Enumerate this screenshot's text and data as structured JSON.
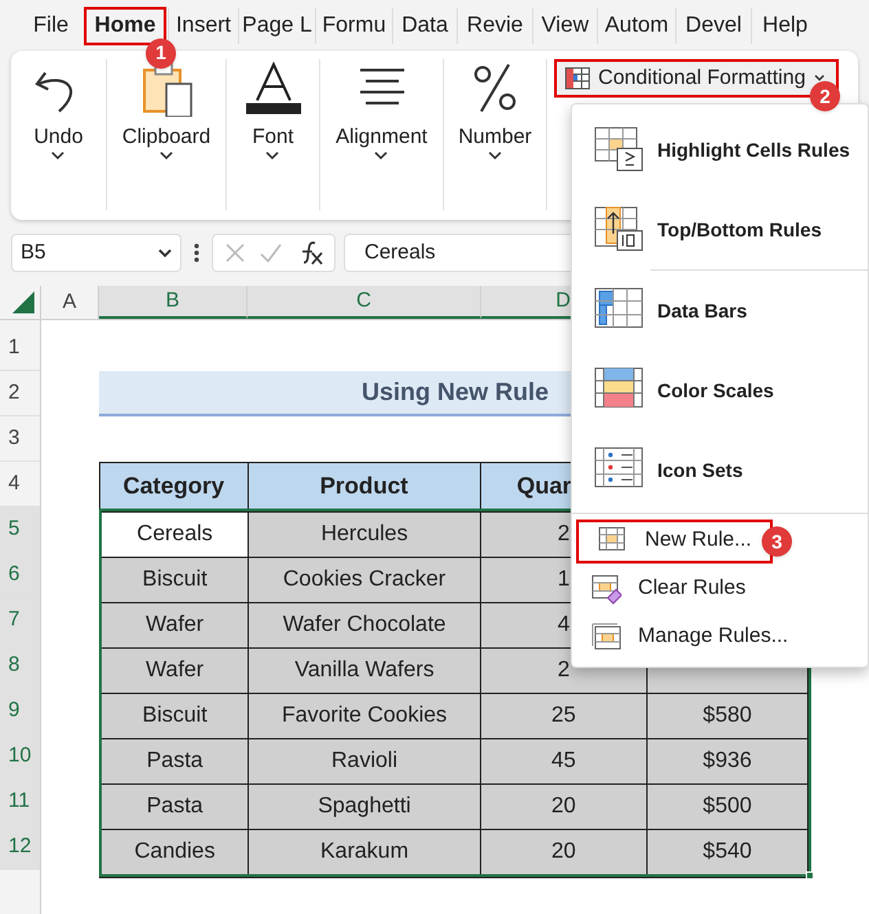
{
  "tabs": [
    {
      "label": "File",
      "selected": false
    },
    {
      "label": "Home",
      "selected": true,
      "callout": "1"
    },
    {
      "label": "Insert",
      "selected": false
    },
    {
      "label": "Page L",
      "selected": false
    },
    {
      "label": "Formu",
      "selected": false
    },
    {
      "label": "Data",
      "selected": false
    },
    {
      "label": "Revie",
      "selected": false
    },
    {
      "label": "View",
      "selected": false
    },
    {
      "label": "Autom",
      "selected": false
    },
    {
      "label": "Devel",
      "selected": false
    },
    {
      "label": "Help",
      "selected": false
    }
  ],
  "ribbon": {
    "groups": [
      "Undo",
      "Clipboard",
      "Font",
      "Alignment",
      "Number"
    ],
    "conditional_formatting": {
      "label": "Conditional Formatting",
      "callout": "2"
    }
  },
  "formula_bar": {
    "name_box": "B5",
    "value": "Cereals"
  },
  "sheet": {
    "columns": [
      {
        "label": "A",
        "selected": false
      },
      {
        "label": "B",
        "selected": true
      },
      {
        "label": "C",
        "selected": true
      },
      {
        "label": "D",
        "selected": true
      }
    ],
    "rows": [
      {
        "label": "1",
        "selected": false
      },
      {
        "label": "2",
        "selected": false
      },
      {
        "label": "3",
        "selected": false
      },
      {
        "label": "4",
        "selected": false
      },
      {
        "label": "5",
        "selected": true
      },
      {
        "label": "6",
        "selected": true
      },
      {
        "label": "7",
        "selected": true
      },
      {
        "label": "8",
        "selected": true
      },
      {
        "label": "9",
        "selected": true
      },
      {
        "label": "10",
        "selected": true
      },
      {
        "label": "11",
        "selected": true
      },
      {
        "label": "12",
        "selected": true
      }
    ],
    "title": "Using New Rule",
    "table": {
      "headers": [
        "Category",
        "Product",
        "Quar"
      ],
      "rows": [
        {
          "cells": [
            "Cereals",
            "Hercules",
            "2"
          ],
          "active": true
        },
        {
          "cells": [
            "Biscuit",
            "Cookies Cracker",
            "1"
          ],
          "active": false
        },
        {
          "cells": [
            "Wafer",
            "Wafer Chocolate",
            "4"
          ],
          "active": false
        },
        {
          "cells": [
            "Wafer",
            "Vanilla Wafers",
            "2"
          ],
          "active": false
        },
        {
          "cells": [
            "Biscuit",
            "Favorite Cookies",
            "25",
            "$580"
          ],
          "active": false
        },
        {
          "cells": [
            "Pasta",
            "Ravioli",
            "45",
            "$936"
          ],
          "active": false
        },
        {
          "cells": [
            "Pasta",
            "Spaghetti",
            "20",
            "$500"
          ],
          "active": false
        },
        {
          "cells": [
            "Candies",
            "Karakum",
            "20",
            "$540"
          ],
          "active": false
        }
      ]
    }
  },
  "menu": {
    "items": [
      {
        "kind": "large",
        "label": "Highlight Cells Rules"
      },
      {
        "kind": "large",
        "label": "Top/Bottom Rules"
      },
      {
        "kind": "large",
        "label": "Data Bars"
      },
      {
        "kind": "large",
        "label": "Color Scales"
      },
      {
        "kind": "large",
        "label": "Icon Sets"
      },
      {
        "kind": "small",
        "label": "New Rule...",
        "callout": "3"
      },
      {
        "kind": "small",
        "label": "Clear Rules"
      },
      {
        "kind": "small",
        "label": "Manage Rules..."
      }
    ]
  }
}
